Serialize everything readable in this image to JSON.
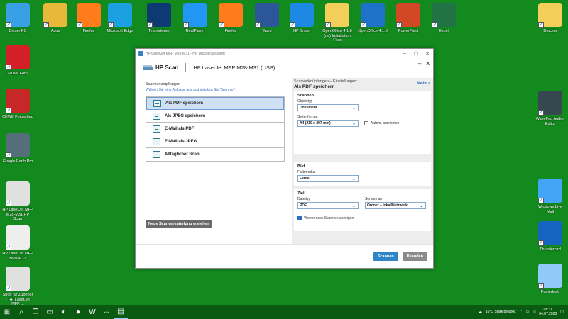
{
  "desktop": {
    "top_icons": [
      {
        "label": "Dieser PC",
        "color": "#3aa0e6"
      },
      {
        "label": "Asus",
        "color": "#e7b83a"
      },
      {
        "label": "Firefox",
        "color": "#ff7b1c"
      },
      {
        "label": "Microsoft Edge",
        "color": "#1ba1e2"
      },
      {
        "label": "TeamViewer",
        "color": "#0e3a73"
      },
      {
        "label": "RealPlayer",
        "color": "#2196f3"
      },
      {
        "label": "Firefox",
        "color": "#ff7b1c"
      },
      {
        "label": "Word",
        "color": "#2b579a"
      },
      {
        "label": "HP Smart",
        "color": "#1e88e5"
      },
      {
        "label": "OpenOffice 4.1.8 (de) Installation Files",
        "color": "#f3cf5a"
      },
      {
        "label": "OpenOffice 4.1.8",
        "color": "#1e73c8"
      },
      {
        "label": "PowerPoint",
        "color": "#d24726"
      },
      {
        "label": "Excel",
        "color": "#217346"
      },
      {
        "label": "Drucker",
        "color": "#f3cf5a"
      }
    ],
    "left_icons": [
      {
        "label": "Müller Foto",
        "color": "#d32027"
      },
      {
        "label": "CEWE Fotoschau",
        "color": "#c62828"
      },
      {
        "label": "Google Earth Pro",
        "color": "#546e7a"
      },
      {
        "label": "HP LaserJet MFP M28-M31 HP Scan",
        "color": "#e0e0e0"
      },
      {
        "label": "HP LaserJet MFP M28-M31",
        "color": "#eeeeee"
      },
      {
        "label": "Shop für Zubehör - HP LaserJet MFP ...",
        "color": "#e0e0e0"
      }
    ],
    "right_icons": [
      {
        "label": "WavePad Audio-Editor",
        "color": "#37474f"
      },
      {
        "label": "Windows Live Mail",
        "color": "#42a5f5"
      },
      {
        "label": "Thunderbird",
        "color": "#1565c0"
      },
      {
        "label": "Papierkorb",
        "color": "#90caf9"
      }
    ]
  },
  "window": {
    "title": "HP LaserJet MFP M28-M31 - HP Druckerassistent",
    "app_name": "HP Scan",
    "device_name": "HP LaserJet MFP M28-M31 (USB)",
    "left": {
      "title": "Scanverknüpfungen",
      "subtitle": "Wählen Sie eine Aufgabe aus und drücken Sie 'Scannen'.",
      "shortcuts": [
        {
          "label": "Als PDF speichern",
          "selected": true
        },
        {
          "label": "Als JPEG speichern",
          "selected": false
        },
        {
          "label": "E-Mail als PDF",
          "selected": false
        },
        {
          "label": "E-Mail als JPEG",
          "selected": false
        },
        {
          "label": "Alltäglicher Scan",
          "selected": false
        }
      ],
      "new_shortcut_label": "Neue Scanverknüpfung erstellen"
    },
    "right": {
      "header": "Scanverknüpfungen – Einstellungen:",
      "profile": "Als PDF speichern",
      "more_label": "Mehr",
      "scan_section": {
        "title": "Scannen",
        "item_type_label": "Objekttyp",
        "item_type_value": "Dokument",
        "page_size_label": "Seitenformat",
        "page_size_value": "A4 (210 x 297 mm)",
        "auto_straighten_label": "Autom. ausrichten"
      },
      "image_section": {
        "title": "Bild",
        "color_mode_label": "Farbmodus",
        "color_mode_value": "Farbe"
      },
      "dest_section": {
        "title": "Ziel",
        "file_type_label": "Dateityp",
        "file_type_value": "PDF",
        "send_to_label": "Senden an",
        "send_to_value": "Ordner – lokal/Netzwerk",
        "show_viewer_label": "Viewer nach Scannen anzeigen"
      }
    },
    "buttons": {
      "scan": "Scannen",
      "close": "Beenden"
    }
  },
  "taskbar": {
    "weather": "16°C  Stark bewölkt",
    "time": "08:11",
    "date": "04.07.2023"
  }
}
